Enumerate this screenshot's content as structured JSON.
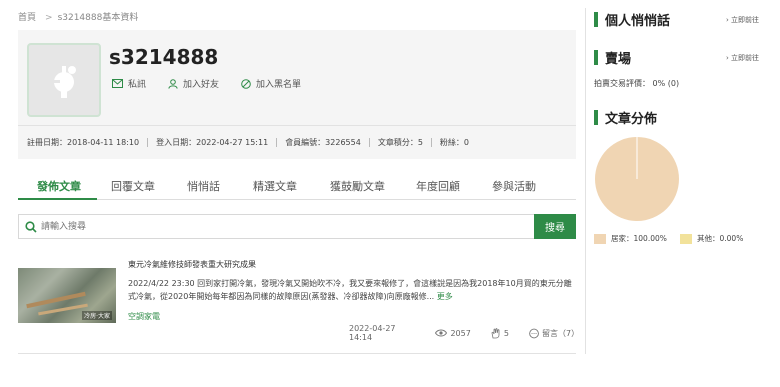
{
  "breadcrumb": {
    "home": "首頁",
    "separator": ">",
    "current": "s3214888基本資料"
  },
  "profile": {
    "username": "s3214888",
    "actions": {
      "message": "私訊",
      "add_friend": "加入好友",
      "blacklist": "加入黑名單"
    },
    "stats": {
      "register": "註冊日期：2018-04-11 18:10",
      "login": "登入日期：2022-04-27 15:11",
      "member_no": "會員編號：3226554",
      "article_points": "文章積分：5",
      "fans": "粉絲：0"
    }
  },
  "tabs": [
    "發佈文章",
    "回覆文章",
    "悄悄話",
    "精選文章",
    "獲鼓勵文章",
    "年度回顧",
    "參與活動"
  ],
  "search": {
    "placeholder": "請輸入搜尋",
    "button": "搜尋"
  },
  "article": {
    "title": "東元冷氣維修技師發表重大研究成果",
    "body": "2022/4/22 23:30 回到家打開冷氣，發現冷氣又開始吹不冷，我又要來報修了，會這樣說是因為我2018年10月買的東元分離式冷氣，從2020年開始每年都因為同樣的故障原因(蒸發器、冷卻器故障)向原廠報修...",
    "more": "更多",
    "category": "空調家電",
    "thumb_watermark": "冷房·大家",
    "date": "2022-04-27 14:14",
    "views": "2057",
    "likes": "5",
    "comments": "留言（7）"
  },
  "sidebar": {
    "whisper": {
      "title": "個人悄悄話",
      "link": "立即前往"
    },
    "market": {
      "title": "賣場",
      "link": "立即前往",
      "rating": "拍賣交易評價： 0% (0)"
    },
    "distribution": {
      "title": "文章分佈"
    }
  },
  "colors": {
    "accent": "#2e8b47",
    "pie_home": "#f0d5b3",
    "pie_other": "#f2e29b"
  },
  "chart_data": {
    "type": "pie",
    "title": "文章分佈",
    "categories": [
      "居家",
      "其他"
    ],
    "values": [
      100.0,
      0.0
    ],
    "labels": [
      "居家：100.00%",
      "其他：0.00%"
    ],
    "colors": [
      "#f0d5b3",
      "#f2e29b"
    ]
  }
}
